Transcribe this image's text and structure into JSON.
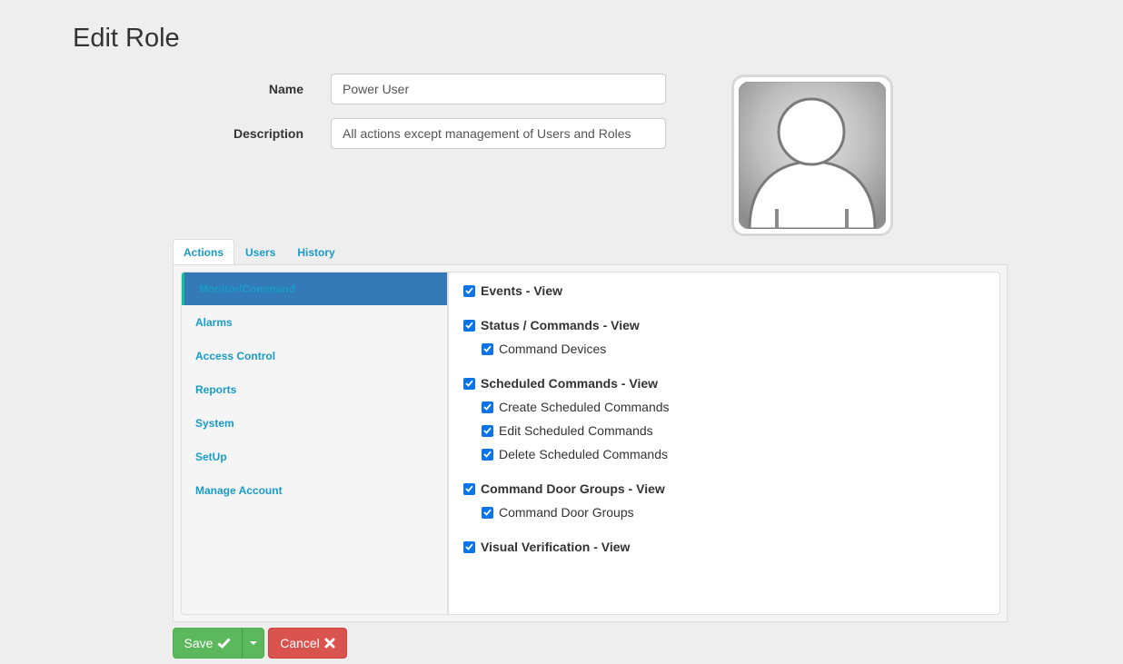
{
  "page": {
    "title": "Edit Role"
  },
  "form": {
    "name_label": "Name",
    "name_value": "Power User",
    "description_label": "Description",
    "description_value": "All actions except management of Users and Roles"
  },
  "tabs": [
    {
      "label": "Actions",
      "active": true
    },
    {
      "label": "Users",
      "active": false
    },
    {
      "label": "History",
      "active": false
    }
  ],
  "sidebar": {
    "items": [
      {
        "label": "Monitor/Command",
        "active": true
      },
      {
        "label": "Alarms"
      },
      {
        "label": "Access Control"
      },
      {
        "label": "Reports"
      },
      {
        "label": "System"
      },
      {
        "label": "SetUp"
      },
      {
        "label": "Manage Account"
      }
    ]
  },
  "permissions": [
    {
      "label": "Events - View",
      "checked": true,
      "level": "main"
    },
    {
      "label": "Status / Commands - View",
      "checked": true,
      "level": "main"
    },
    {
      "label": "Command Devices",
      "checked": true,
      "level": "sub"
    },
    {
      "label": "Scheduled Commands - View",
      "checked": true,
      "level": "main"
    },
    {
      "label": "Create Scheduled Commands",
      "checked": true,
      "level": "sub"
    },
    {
      "label": "Edit Scheduled Commands",
      "checked": true,
      "level": "sub"
    },
    {
      "label": "Delete Scheduled Commands",
      "checked": true,
      "level": "sub"
    },
    {
      "label": "Command Door Groups - View",
      "checked": true,
      "level": "main"
    },
    {
      "label": "Command Door Groups",
      "checked": true,
      "level": "sub"
    },
    {
      "label": "Visual Verification - View",
      "checked": true,
      "level": "main"
    }
  ],
  "actions": {
    "save_label": "Save",
    "save_icon": "check-icon",
    "cancel_label": "Cancel",
    "cancel_icon": "close-icon"
  },
  "colors": {
    "accent": "#1a9bc7",
    "active_item_bg": "#337ab7",
    "checkbox": "#0b75e8",
    "save": "#5cb85c",
    "cancel": "#d9534f"
  }
}
